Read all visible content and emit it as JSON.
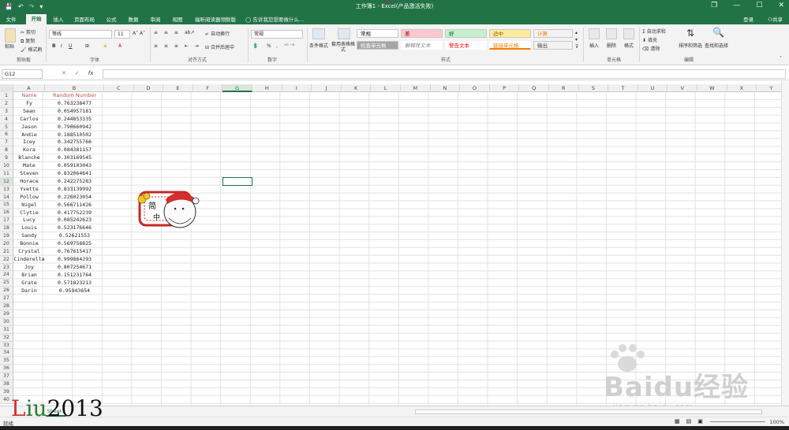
{
  "titlebar": {
    "title": "工作簿1 - Excel(产品激活失败)",
    "save_icon": "💾",
    "undo_icon": "↶",
    "redo_icon": "↷",
    "more_icon": "▾",
    "restore_icon": "❐",
    "minimize": "—",
    "maximize": "☐",
    "close": "✕"
  },
  "tabs": [
    "文件",
    "开始",
    "插入",
    "页面布局",
    "公式",
    "数据",
    "审阅",
    "视图",
    "福昕阅读器领鲜版"
  ],
  "active_tab": "开始",
  "tell_me": "告诉我您想要做什么...",
  "account": {
    "login": "登录",
    "share": "共享"
  },
  "ribbon": {
    "clipboard": {
      "paste": "粘贴",
      "cut": "剪切",
      "copy": "复制",
      "format_painter": "格式刷",
      "label": "剪贴板"
    },
    "font": {
      "name": "等线",
      "size": "11",
      "bold": "B",
      "italic": "I",
      "underline": "U",
      "label": "字体"
    },
    "alignment": {
      "wrap": "自动换行",
      "merge": "合并后居中",
      "label": "对齐方式"
    },
    "number": {
      "format": "常规",
      "percent": "%",
      "comma": ",",
      "label": "数字"
    },
    "styles": {
      "conditional": "条件格式",
      "table": "套用表格格式",
      "label": "样式",
      "items": [
        {
          "label": "常规",
          "bg": "#ffffff",
          "fg": "#000000"
        },
        {
          "label": "差",
          "bg": "#ffc7ce",
          "fg": "#9c0006"
        },
        {
          "label": "好",
          "bg": "#c6efce",
          "fg": "#006100"
        },
        {
          "label": "适中",
          "bg": "#ffeb9c",
          "fg": "#9c5700"
        },
        {
          "label": "计算",
          "bg": "#f2f2f2",
          "fg": "#fa7d00"
        },
        {
          "label": "检查单元格",
          "bg": "#a5a5a5",
          "fg": "#ffffff"
        },
        {
          "label": "解释性文本",
          "bg": "#ffffff",
          "fg": "#7f7f7f"
        },
        {
          "label": "警告文本",
          "bg": "#ffffff",
          "fg": "#ff0000"
        },
        {
          "label": "链接单元格",
          "bg": "#ffffff",
          "fg": "#fa7d00"
        },
        {
          "label": "输出",
          "bg": "#f2f2f2",
          "fg": "#3f3f3f"
        }
      ]
    },
    "cells": {
      "insert": "插入",
      "delete": "删除",
      "format": "格式",
      "label": "单元格"
    },
    "editing": {
      "autosum": "自动求和",
      "fill": "填充",
      "clear": "清除",
      "sort": "排序和筛选",
      "find": "查找和选择",
      "label": "编辑"
    }
  },
  "formula_bar": {
    "name_box": "G12",
    "cancel": "✕",
    "enter": "✓",
    "fx": "fx",
    "value": ""
  },
  "columns": [
    "A",
    "B",
    "C",
    "D",
    "E",
    "F",
    "G",
    "H",
    "I",
    "J",
    "K",
    "L",
    "M",
    "N",
    "O",
    "P",
    "Q",
    "R",
    "S",
    "T",
    "U",
    "V",
    "W",
    "X",
    "Y"
  ],
  "selected_column": "G",
  "selected_row": 12,
  "row_count": 40,
  "table": {
    "headers": [
      "Name",
      "Random Number"
    ],
    "rows": [
      [
        "Fy",
        "0.763238477"
      ],
      [
        "Sean",
        "0.054957181"
      ],
      [
        "Carlos",
        "0.244853335"
      ],
      [
        "Jason",
        "0.790660942"
      ],
      [
        "Andie",
        "0.188510502"
      ],
      [
        "Icey",
        "0.342755766"
      ],
      [
        "Kora",
        "0.084381157"
      ],
      [
        "Blanche",
        "0.303169545"
      ],
      [
        "Mate",
        "0.059103043"
      ],
      [
        "Steven",
        "0.832064641"
      ],
      [
        "Horace",
        "0.242275283"
      ],
      [
        "Yvette",
        "0.833139992"
      ],
      [
        "Pollow",
        "0.226023054"
      ],
      [
        "Nigel",
        "0.566711426"
      ],
      [
        "Clytie",
        "0.417752239"
      ],
      [
        "Lucy",
        "0.085242623"
      ],
      [
        "Louis",
        "0.523176646"
      ],
      [
        "Sandy",
        "0.52621553"
      ],
      [
        "Bonnie",
        "0.569758825"
      ],
      [
        "Crystal",
        "0.767615417"
      ],
      [
        "Cinderella",
        "0.999864293"
      ],
      [
        "Joy",
        "0.807254671"
      ],
      [
        "Brian",
        "0.151231764"
      ],
      [
        "Grate",
        "0.571823213"
      ],
      [
        "Darin",
        "0.95943654"
      ]
    ]
  },
  "sheet_tab": "Sheet1",
  "status": {
    "ready": "就绪",
    "zoom": "100%"
  },
  "watermark": {
    "part1": "L",
    "part2": "iu",
    "part3": "2013"
  },
  "baidu": {
    "text": "Baidu经验",
    "url": "jingyan.baidu.com"
  },
  "sticker": {
    "top_char": "简",
    "bottom_char": "中"
  },
  "colors": {
    "excel_green": "#217346",
    "header_red": "#c0504d"
  }
}
